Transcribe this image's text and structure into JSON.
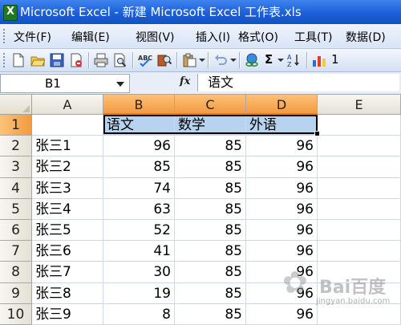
{
  "window": {
    "title": "Microsoft Excel - 新建 Microsoft Excel 工作表.xls"
  },
  "menu": {
    "items": [
      "文件(F)",
      "编辑(E)",
      "视图(V)",
      "插入(I)",
      "格式(O)",
      "工具(T)",
      "数据(D)"
    ]
  },
  "toolbar": {
    "sigma_label": "Σ",
    "trailing_text": "1"
  },
  "formula_bar": {
    "name_box": "B1",
    "fx_label": "fx",
    "content": "语文"
  },
  "sheet": {
    "columns": [
      "A",
      "B",
      "C",
      "D",
      "E"
    ],
    "selected_columns": [
      "B",
      "C",
      "D"
    ],
    "rows": [
      {
        "num": "1",
        "cells": [
          "",
          "语文",
          "数学",
          "外语",
          ""
        ]
      },
      {
        "num": "2",
        "cells": [
          "张三1",
          "96",
          "85",
          "96",
          ""
        ]
      },
      {
        "num": "3",
        "cells": [
          "张三2",
          "85",
          "85",
          "96",
          ""
        ]
      },
      {
        "num": "4",
        "cells": [
          "张三3",
          "74",
          "85",
          "96",
          ""
        ]
      },
      {
        "num": "5",
        "cells": [
          "张三4",
          "63",
          "85",
          "96",
          ""
        ]
      },
      {
        "num": "6",
        "cells": [
          "张三5",
          "52",
          "85",
          "96",
          ""
        ]
      },
      {
        "num": "7",
        "cells": [
          "张三6",
          "41",
          "85",
          "96",
          ""
        ]
      },
      {
        "num": "8",
        "cells": [
          "张三7",
          "30",
          "85",
          "96",
          ""
        ]
      },
      {
        "num": "9",
        "cells": [
          "张三8",
          "19",
          "85",
          "96",
          ""
        ]
      },
      {
        "num": "10",
        "cells": [
          "张三9",
          "8",
          "85",
          "96",
          ""
        ]
      }
    ]
  },
  "watermark": {
    "brand": "Bai百度",
    "sub": "jingyan.baidu.com"
  }
}
